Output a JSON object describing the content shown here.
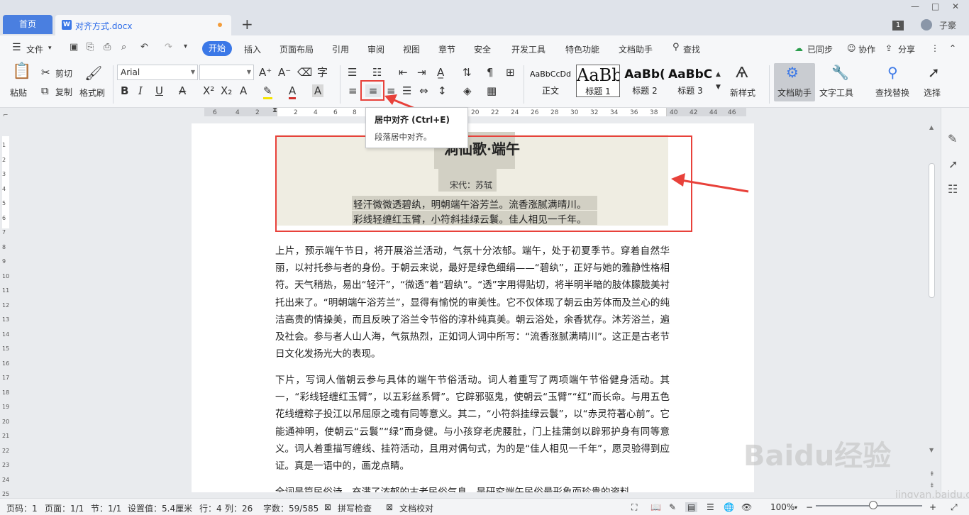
{
  "tabs": {
    "home": "首页",
    "document": "对齐方式.docx",
    "new_tab": "+"
  },
  "window": {
    "page_num": "1",
    "user": "子豪",
    "min": "—",
    "max": "□",
    "close": "✕"
  },
  "menu": {
    "file": "文件",
    "items": [
      "开始",
      "插入",
      "页面布局",
      "引用",
      "审阅",
      "视图",
      "章节",
      "安全",
      "开发工具",
      "特色功能",
      "文档助手",
      "查找"
    ],
    "right": [
      "已同步",
      "协作",
      "分享"
    ]
  },
  "ribbon": {
    "paste": "粘贴",
    "cut": "剪切",
    "copy": "复制",
    "format_painter": "格式刷",
    "font_name": "Arial",
    "font_size": "",
    "styles": [
      {
        "sample": "AaBbCcDd",
        "name": "正文"
      },
      {
        "sample": "AaBb",
        "name": "标题 1"
      },
      {
        "sample": "AaBb(",
        "name": "标题 2"
      },
      {
        "sample": "AaBbC",
        "name": "标题 3"
      }
    ],
    "new_style": "新样式",
    "doc_assistant": "文档助手",
    "text_tools": "文字工具",
    "find_replace": "查找替换",
    "select": "选择"
  },
  "tooltip": {
    "title": "居中对齐 (Ctrl+E)",
    "desc": "段落居中对齐。"
  },
  "ruler": {
    "marks": [
      "6",
      "4",
      "2",
      "2",
      "4",
      "6",
      "8",
      "10",
      "12",
      "14",
      "16",
      "18",
      "20",
      "22",
      "24",
      "26",
      "28",
      "30",
      "32",
      "34",
      "36",
      "38",
      "40",
      "42",
      "44",
      "46"
    ]
  },
  "vruler": [
    "1",
    "2",
    "3",
    "4",
    "5",
    "6",
    "7",
    "8",
    "9",
    "10",
    "11",
    "12",
    "13",
    "14",
    "15",
    "16",
    "17",
    "18",
    "19",
    "20",
    "21",
    "22",
    "23",
    "24",
    "25"
  ],
  "document": {
    "title": "洞仙歌·端午",
    "author": "宋代：苏轼",
    "poem": [
      "轻汗微微透碧纨，明朝端午浴芳兰。流香涨腻满晴川。",
      "彩线轻缠红玉臂，小符斜挂绿云鬟。佳人相见一千年。"
    ],
    "para1": "上片，预示端午节日，将开展浴兰活动，气氛十分浓郁。端午，处于初夏季节。穿着自然华丽，以衬托参与者的身份。于朝云来说，最好是绿色细绢——“碧纨”，正好与她的雅静性格相符。天气稍热，易出“轻汗”，“微透”着“碧纨”。“透”字用得贴切，将半明半暗的肢体朦胧美衬托出来了。“明朝端午浴芳兰”，显得有愉悦的审美性。它不仅体现了朝云由芳体而及兰心的纯洁高贵的情操美，而且反映了浴兰令节俗的淳朴纯真美。朝云浴处，余香犹存。沐芳浴兰，遍及社会。参与者人山人海，气氛热烈，正如词人词中所写：“流香涨腻满晴川”。这正是古老节日文化发扬光大的表现。",
    "para2": "下片，写词人偕朝云参与具体的端午节俗活动。词人着重写了两项端午节俗健身活动。其一，“彩线轻缠红玉臂”，以五彩丝系臂”。它辟邪驱鬼，使朝云“玉臂”“红”而长命。与用五色花线缠粽子投江以吊屈原之魂有同等意义。其二，“小符斜挂绿云鬟”，以“赤灵符著心前”。它能通神明，使朝云“云鬟”“绿”而身健。与小孩穿老虎腰肚，门上挂蒲剑以辟邪护身有同等意义。词人着重描写缠线、挂符活动，且用对偶句式，为的是“佳人相见一千年”，愿灵验得到应证。真是一语中的，画龙点睛。",
    "para3": "全词是篇民俗诗，充满了浓郁的古老民俗气息，是研究端午民俗最形象而珍贵的资料。"
  },
  "status": {
    "page_code": "页码：1",
    "page": "页面：1/1",
    "section": "节：1/1",
    "setting": "设置值：5.4厘米",
    "row": "行：4",
    "col": "列：26",
    "words": "字数：59/585",
    "spell": "拼写检查",
    "proof": "文档校对",
    "zoom": "100%"
  },
  "watermark": {
    "brand": "Baidu经验",
    "url": "jingyan.baidu.com"
  }
}
